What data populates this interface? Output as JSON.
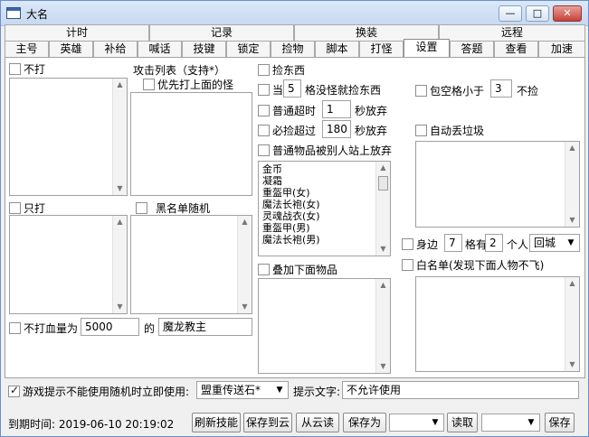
{
  "window": {
    "title": "大名",
    "min": "—",
    "max": "□",
    "close": "✕"
  },
  "tabs_top": [
    "计时",
    "记录",
    "换装",
    "远程"
  ],
  "tabs_bottom": [
    "主号",
    "英雄",
    "补给",
    "喊话",
    "技键",
    "锁定",
    "捡物",
    "脚本",
    "打怪",
    "设置",
    "答题",
    "查看",
    "加速"
  ],
  "left": {
    "no_hit": "不打",
    "attack_list": "攻击列表（支持*）",
    "priority": "优先打上面的怪",
    "only_hit": "只打",
    "blacklist_random": "黑名单随机",
    "no_hit_hp": "不打血量为",
    "hp_value": "5000",
    "of": "的",
    "boss": "魔龙教主"
  },
  "middle": {
    "pick": "捡东西",
    "when": "当",
    "when_n": "5",
    "when_tail": "格没怪就捡东西",
    "normal_timeout": "普通超时",
    "normal_n": "1",
    "sec_give": "秒放弃",
    "must_timeout": "必捡超过",
    "must_n": "180",
    "sec_give2": "秒放弃",
    "others_stand": "普通物品被别人站上放弃",
    "items": [
      "金币",
      "凝霜",
      "重盔甲(女)",
      "魔法长袍(女)",
      "灵魂战衣(女)",
      "重盔甲(男)",
      "魔法长袍(男)"
    ],
    "stack": "叠加下面物品"
  },
  "right": {
    "bag_less": "包空格小于",
    "bag_n": "3",
    "no_pick": "不捡",
    "auto_drop": "自动丢垃圾",
    "near": "身边",
    "near_n": "7",
    "grid_has": "格有",
    "people_n": "2",
    "people": "个人",
    "action": "回城",
    "whitelist": "白名单(发现下面人物不飞)"
  },
  "bottom": {
    "game_tip": "游戏提示不能使用随机时立即使用:",
    "scroll": "盟重传送石*",
    "tip_text_label": "提示文字:",
    "tip_text": "不允许使用",
    "expire": "到期时间: 2019-06-10 20:19:02",
    "refresh": "刷新技能",
    "save_cloud": "保存到云",
    "load_cloud": "从云读",
    "save_as": "保存为",
    "read": "读取",
    "save": "保存"
  }
}
